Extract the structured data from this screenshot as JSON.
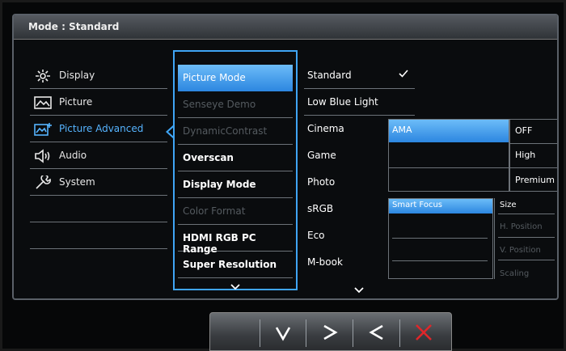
{
  "header": {
    "title": "Mode :  Standard"
  },
  "main_menu": [
    {
      "label": "Display",
      "icon": "display-icon",
      "active": false
    },
    {
      "label": "Picture",
      "icon": "picture-icon",
      "active": false
    },
    {
      "label": "Picture Advanced",
      "icon": "picture-advanced-icon",
      "active": true
    },
    {
      "label": "Audio",
      "icon": "audio-icon",
      "active": false
    },
    {
      "label": "System",
      "icon": "system-icon",
      "active": false
    }
  ],
  "submenu": [
    {
      "label": "Picture Mode",
      "state": "selected"
    },
    {
      "label": "Senseye Demo",
      "state": "disabled"
    },
    {
      "label": "DynamicContrast",
      "state": "disabled"
    },
    {
      "label": "Overscan",
      "state": "enabled"
    },
    {
      "label": "Display Mode",
      "state": "enabled"
    },
    {
      "label": "Color Format",
      "state": "disabled"
    },
    {
      "label": "HDMI RGB PC Range",
      "state": "enabled"
    },
    {
      "label": "Super Resolution",
      "state": "enabled"
    }
  ],
  "options": [
    {
      "label": "Standard",
      "checked": true
    },
    {
      "label": "Low Blue Light",
      "checked": false
    },
    {
      "label": "Cinema",
      "checked": false
    },
    {
      "label": "Game",
      "checked": false
    },
    {
      "label": "Photo",
      "checked": false
    },
    {
      "label": "sRGB",
      "checked": false
    },
    {
      "label": "Eco",
      "checked": false
    },
    {
      "label": "M-book",
      "checked": false
    }
  ],
  "ama_popup": {
    "title": "AMA",
    "values": [
      "OFF",
      "High",
      "Premium"
    ]
  },
  "smart_focus_popup": {
    "title": "Smart Focus",
    "values": [
      {
        "label": "Size",
        "enabled": true
      },
      {
        "label": "H. Position",
        "enabled": false
      },
      {
        "label": "V. Position",
        "enabled": false
      },
      {
        "label": "Scaling",
        "enabled": false
      }
    ]
  },
  "keys": [
    {
      "icon": "chevron-down-icon"
    },
    {
      "icon": "chevron-right-icon"
    },
    {
      "icon": "chevron-left-icon"
    },
    {
      "icon": "close-icon"
    }
  ],
  "colors": {
    "accent": "#3fa5f5",
    "close": "#e0262a"
  }
}
